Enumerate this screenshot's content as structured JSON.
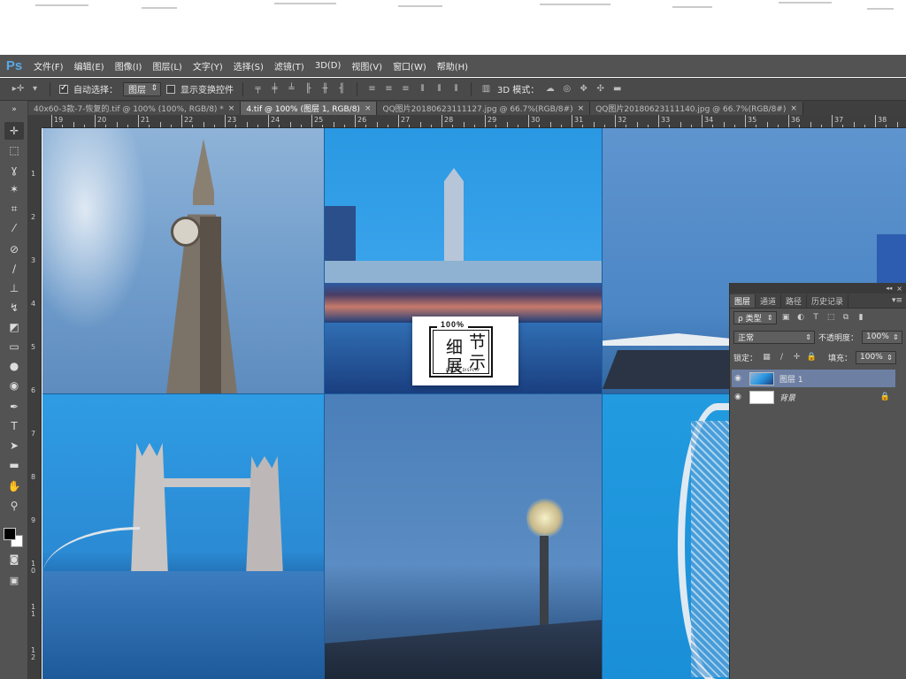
{
  "app": {
    "logo": "Ps"
  },
  "menu": [
    "文件(F)",
    "编辑(E)",
    "图像(I)",
    "图层(L)",
    "文字(Y)",
    "选择(S)",
    "滤镜(T)",
    "3D(D)",
    "视图(V)",
    "窗口(W)",
    "帮助(H)"
  ],
  "options": {
    "auto_select_label": "自动选择：",
    "auto_select_value": "图层",
    "show_transform_label": "显示变换控件",
    "mode_3d_label": "3D 模式："
  },
  "tabs": [
    {
      "title": "40x60-3款-7-恢复的.tif @ 100% (100%, RGB/8) *",
      "close": "×"
    },
    {
      "title": "4.tif @ 100% (图层 1, RGB/8)",
      "close": "×"
    },
    {
      "title": "QQ图片20180623111127.jpg @ 66.7%(RGB/8#)",
      "close": "×"
    },
    {
      "title": "QQ图片20180623111140.jpg @ 66.7%(RGB/8#)",
      "close": "×"
    }
  ],
  "ruler_top": [
    "19",
    "20",
    "21",
    "22",
    "23",
    "24",
    "25",
    "26",
    "27",
    "28",
    "29",
    "30",
    "31",
    "32",
    "33",
    "34",
    "35",
    "36",
    "37",
    "38"
  ],
  "ruler_left": [
    "1",
    "2",
    "3",
    "4",
    "5",
    "6",
    "7",
    "8",
    "9",
    "1\n0",
    "1\n1",
    "1\n2"
  ],
  "detail_card": {
    "badge": "100%",
    "char1": "细",
    "char2": "节",
    "char3": "展",
    "char4": "示",
    "subtitle": "DETAIL DISPLAY"
  },
  "layers_panel": {
    "tabs": [
      "图层",
      "通道",
      "路径",
      "历史记录"
    ],
    "filter_kind": "ρ 类型",
    "blend_mode": "正常",
    "opacity_label": "不透明度：",
    "opacity_value": "100%",
    "lock_label": "锁定：",
    "fill_label": "填充：",
    "fill_value": "100%",
    "layers": [
      {
        "name": "图层 1",
        "selected": true
      },
      {
        "name": "背景",
        "selected": false,
        "locked": true
      }
    ]
  },
  "colors": {
    "accent": "#5aa9e6",
    "ui_dark": "#535353",
    "selection": "#6d7fa3"
  }
}
